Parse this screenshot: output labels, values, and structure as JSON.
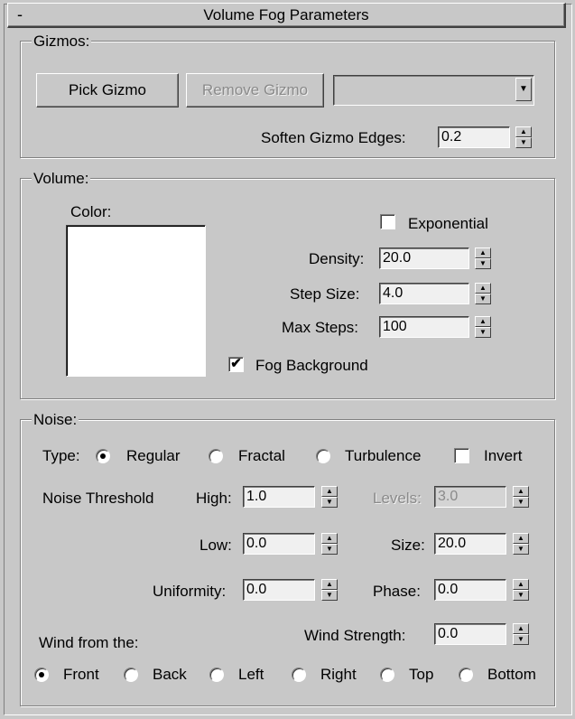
{
  "rollout": {
    "collapse_symbol": "-",
    "title": "Volume Fog Parameters"
  },
  "gizmos": {
    "label": "Gizmos:",
    "pick_button": "Pick Gizmo",
    "remove_button": "Remove Gizmo",
    "combo_value": "",
    "soften_label": "Soften Gizmo Edges:",
    "soften_value": "0.2"
  },
  "volume": {
    "label": "Volume:",
    "color_label": "Color:",
    "color_value": "#ffffff",
    "exponential_label": "Exponential",
    "exponential_checked": false,
    "density_label": "Density:",
    "density_value": "20.0",
    "step_size_label": "Step Size:",
    "step_size_value": "4.0",
    "max_steps_label": "Max Steps:",
    "max_steps_value": "100",
    "fog_background_label": "Fog Background",
    "fog_background_checked": true,
    "check_mark": "✔"
  },
  "noise": {
    "label": "Noise:",
    "type_label": "Type:",
    "types": [
      "Regular",
      "Fractal",
      "Turbulence"
    ],
    "type_selected": "Regular",
    "invert_label": "Invert",
    "invert_checked": false,
    "threshold_label": "Noise Threshold",
    "high_label": "High:",
    "high_value": "1.0",
    "levels_label": "Levels:",
    "levels_value": "3.0",
    "low_label": "Low:",
    "low_value": "0.0",
    "size_label": "Size:",
    "size_value": "20.0",
    "uniformity_label": "Uniformity:",
    "uniformity_value": "0.0",
    "phase_label": "Phase:",
    "phase_value": "0.0",
    "wind_strength_label": "Wind Strength:",
    "wind_strength_value": "0.0",
    "wind_from_label": "Wind from the:",
    "wind_dirs": [
      "Front",
      "Back",
      "Left",
      "Right",
      "Top",
      "Bottom"
    ],
    "wind_selected": "Front"
  }
}
